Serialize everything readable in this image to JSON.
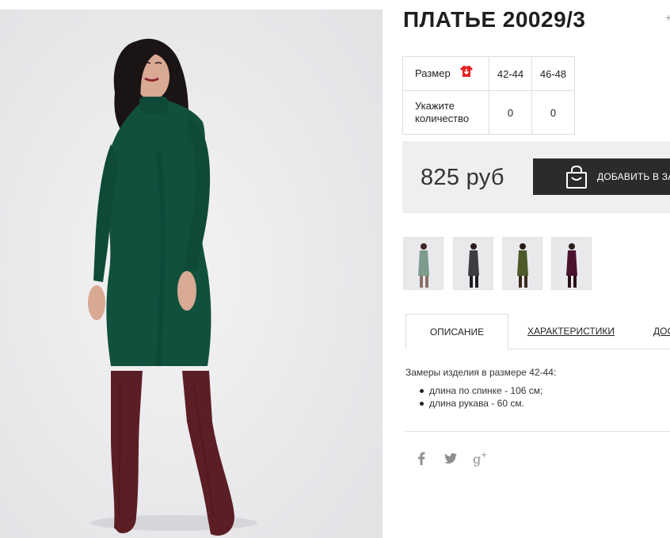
{
  "product": {
    "title": "ПЛАТЬЕ 20029/3",
    "image_alt": "Model in long-sleeve green turtleneck dress with burgundy suede over-the-knee boots"
  },
  "size_table": {
    "size_label": "Размер",
    "size_guide_icon": "shirt-arrow-icon",
    "sizes": [
      "42-44",
      "46-48"
    ],
    "qty_label_line1": "Укажите",
    "qty_label_line2": "количество",
    "quantities": [
      "0",
      "0"
    ]
  },
  "purchase": {
    "price": "825 руб",
    "add_to_cart_label": "ДОБАВИТЬ В ЗАКАЗ",
    "cart_icon": "shopping-bag-icon"
  },
  "thumbnails": [
    {
      "name": "green",
      "color": "#7c9b8c"
    },
    {
      "name": "gray",
      "color": "#3c3d42"
    },
    {
      "name": "olive",
      "color": "#4d5a2a"
    },
    {
      "name": "burgundy",
      "color": "#4b1230"
    }
  ],
  "tabs": {
    "active": "ОПИСАНИЕ",
    "specs": "ХАРАКТЕРИСТИКИ",
    "delivery": "ДОСТАВКА"
  },
  "description": {
    "intro": "Замеры изделия в размере 42-44:",
    "items": [
      "длина по спинке - 106 см;",
      "длина рукава - 60 см."
    ]
  },
  "social": {
    "facebook": "f",
    "twitter": "twitter-bird-icon",
    "googleplus": "g+"
  },
  "colors": {
    "dress": "#11503d",
    "boots": "#5c1e25",
    "button": "#2b2b2b",
    "price_bg": "#efefef",
    "size_icon": "#e52222"
  }
}
